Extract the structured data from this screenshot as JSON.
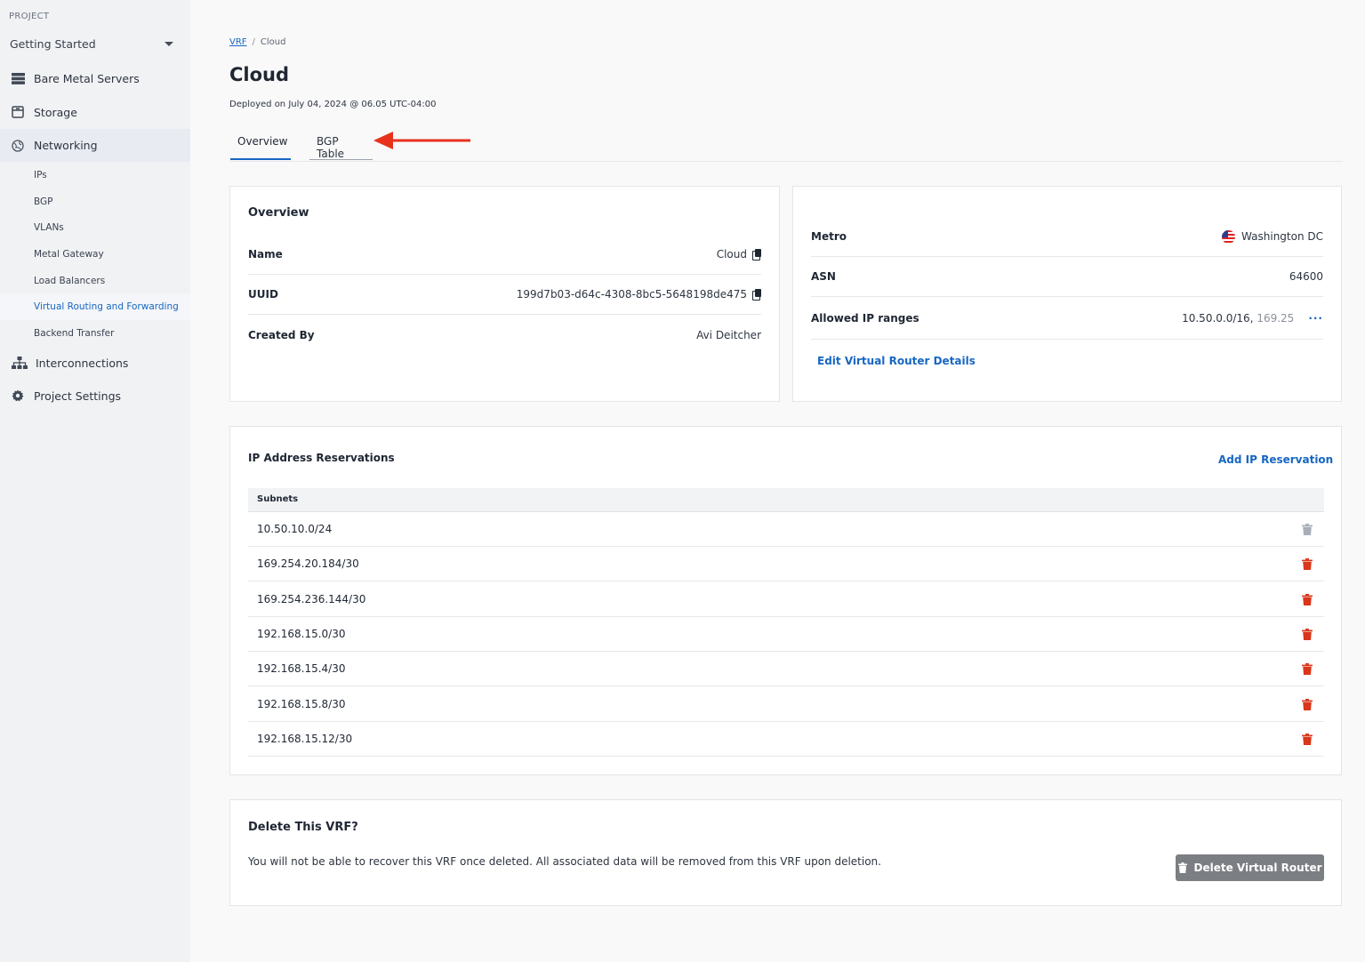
{
  "sidebar": {
    "project_label": "PROJECT",
    "project_name": "Getting Started",
    "items": [
      {
        "label": "Bare Metal Servers",
        "icon": "server-icon"
      },
      {
        "label": "Storage",
        "icon": "storage-icon"
      },
      {
        "label": "Networking",
        "icon": "globe-icon"
      },
      {
        "label": "Interconnections",
        "icon": "hierarchy-icon"
      },
      {
        "label": "Project Settings",
        "icon": "gear-icon"
      }
    ],
    "networking_sub": [
      "IPs",
      "BGP",
      "VLANs",
      "Metal Gateway",
      "Load Balancers",
      "Virtual Routing and Forwarding",
      "Backend Transfer"
    ]
  },
  "breadcrumb": {
    "parent": "VRF",
    "sep": "/",
    "current": "Cloud"
  },
  "page": {
    "title": "Cloud",
    "deployed": "Deployed on July 04, 2024 @ 06.05 UTC-04:00"
  },
  "tabs": [
    "Overview",
    "BGP Table"
  ],
  "overview": {
    "title": "Overview",
    "rows": [
      {
        "label": "Name",
        "value": "Cloud"
      },
      {
        "label": "UUID",
        "value": "199d7b03-d64c-4308-8bc5-5648198de475"
      },
      {
        "label": "Created By",
        "value": "Avi Deitcher"
      }
    ]
  },
  "router": {
    "metro_label": "Metro",
    "metro_value": "Washington DC",
    "asn_label": "ASN",
    "asn_value": "64600",
    "ranges_label": "Allowed IP ranges",
    "ranges_value": "10.50.0.0/16, ",
    "ranges_fade": "169.25",
    "more": "···",
    "edit_link": "Edit Virtual Router Details"
  },
  "reservations": {
    "title": "IP Address Reservations",
    "add_link": "Add IP Reservation",
    "column": "Subnets",
    "subnets": [
      "10.50.10.0/24",
      "169.254.20.184/30",
      "169.254.236.144/30",
      "192.168.15.0/30",
      "192.168.15.4/30",
      "192.168.15.8/30",
      "192.168.15.12/30"
    ]
  },
  "delete": {
    "title": "Delete This VRF?",
    "text": "You will not be able to recover this VRF once deleted. All associated data will be removed from this VRF upon deletion.",
    "button": "Delete Virtual Router"
  },
  "colors": {
    "accent": "#1767c2",
    "danger": "#d9361b",
    "disabled_trash": "#a8aeb8",
    "annotation": "#e8321e"
  }
}
